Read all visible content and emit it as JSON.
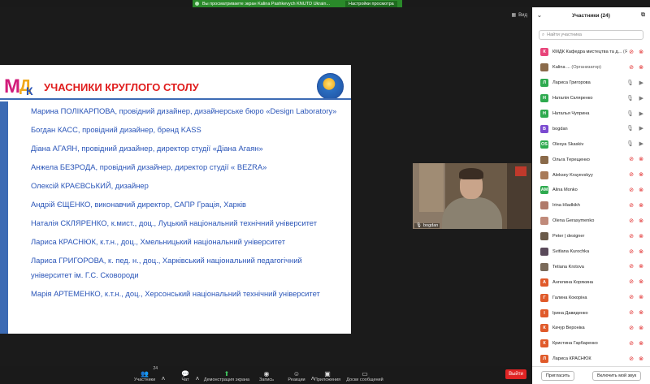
{
  "share_banner": {
    "text": "Вы просматриваете экран Kalina Pashkevych KNUTD Ukrain...",
    "options": "Настройки просмотра"
  },
  "view_label": "Вид",
  "slide": {
    "title": "УЧАСНИКИ КРУГЛОГО СТОЛУ",
    "items": [
      "Марина ПОЛІКАРПОВА, провідний дизайнер, дизайнерське бюро «Design Laboratory»",
      "Богдан КАСС, провідний дизайнер, бренд KASS",
      "Діана АГАЯН, провідний дизайнер, директор студії «Діана Агаян»",
      "Анжела БЕЗРОДА, провідний дизайнер, директор студії « BEZRA»",
      "Олексій КРАЄВСЬКИЙ, дизайнер",
      "Андрій ЄЩЕНКО, виконавчий директор, САПР Грація, Харків",
      "Наталія СКЛЯРЕНКО, к.мист., доц., Луцький національний технічний університет",
      "Лариса КРАСНЮК, к.т.н., доц., Хмельницький національний університет",
      "Лариса ГРИГОРОВА, к. пед. н., доц., Харківський національний педагогічний університет  ім. Г.С. Сковороди",
      "Марія АРТЕМЕНКО, к.т.н., доц., Херсонський національний технічний університет"
    ]
  },
  "camera": {
    "name": "bogdan"
  },
  "toolbar": {
    "audio": "Звук",
    "video": "Видео",
    "participants": "Участники",
    "participants_count": "24",
    "chat": "Чат",
    "share": "Демонстрация экрана",
    "record": "Запись",
    "reactions": "Реакции",
    "apps": "Приложения",
    "whiteboard": "Доски сообщений",
    "end": "Выйти"
  },
  "panel": {
    "title": "Участники (24)",
    "search_placeholder": "Найти участника",
    "participants": [
      {
        "initial": "К",
        "color": "#e8447a",
        "name": "КМДК Кафедра мистецтва та д...",
        "tag": " (Я)",
        "mic": "muted",
        "cam": "off"
      },
      {
        "initial": "",
        "color": "#8a6a4a",
        "name": "Kalina ...",
        "tag": " (Организатор)",
        "mic": "muted",
        "cam": "off"
      },
      {
        "initial": "Л",
        "color": "#2eaa4f",
        "name": "Лариса Григорова",
        "tag": "",
        "mic": "on",
        "cam": "on"
      },
      {
        "initial": "Н",
        "color": "#2eaa4f",
        "name": "Наталія Скляренко",
        "tag": "",
        "mic": "on",
        "cam": "on"
      },
      {
        "initial": "Н",
        "color": "#2eaa4f",
        "name": "Наталья Чуприна",
        "tag": "",
        "mic": "on",
        "cam": "on"
      },
      {
        "initial": "B",
        "color": "#7b4ad0",
        "name": "bogdan",
        "tag": "",
        "mic": "on",
        "cam": "on"
      },
      {
        "initial": "OS",
        "color": "#2eaa4f",
        "name": "Olesya Skaskiv",
        "tag": "",
        "mic": "on",
        "cam": "on"
      },
      {
        "initial": "",
        "color": "#8a6a4a",
        "name": "Ольга Терещенко",
        "tag": "",
        "mic": "muted",
        "cam": "off"
      },
      {
        "initial": "",
        "color": "#a87a58",
        "name": "Aleksey Krayevskyy",
        "tag": "",
        "mic": "muted",
        "cam": "off"
      },
      {
        "initial": "AM",
        "color": "#2eaa4f",
        "name": "Alina Monko",
        "tag": "",
        "mic": "muted",
        "cam": "off"
      },
      {
        "initial": "",
        "color": "#b07a6a",
        "name": "Irina Hladkikh",
        "tag": "",
        "mic": "muted",
        "cam": "off"
      },
      {
        "initial": "",
        "color": "#c08a7a",
        "name": "Olena Gerasymenko",
        "tag": "",
        "mic": "muted",
        "cam": "off"
      },
      {
        "initial": "",
        "color": "#6a5a4a",
        "name": "Peter | designer",
        "tag": "",
        "mic": "muted",
        "cam": "off"
      },
      {
        "initial": "",
        "color": "#5a4a5a",
        "name": "Svitlana Kurochka",
        "tag": "",
        "mic": "muted",
        "cam": "off"
      },
      {
        "initial": "",
        "color": "#7a6a5a",
        "name": "Tetiana Krotova",
        "tag": "",
        "mic": "muted",
        "cam": "off"
      },
      {
        "initial": "А",
        "color": "#e05a2a",
        "name": "Ангелина Корякина",
        "tag": "",
        "mic": "muted",
        "cam": "off"
      },
      {
        "initial": "Г",
        "color": "#e05a2a",
        "name": "Галина Кокоріна",
        "tag": "",
        "mic": "muted",
        "cam": "off"
      },
      {
        "initial": "І",
        "color": "#e05a2a",
        "name": "Ірина Давиденко",
        "tag": "",
        "mic": "muted",
        "cam": "off"
      },
      {
        "initial": "К",
        "color": "#e05a2a",
        "name": "Качур Вероніка",
        "tag": "",
        "mic": "muted",
        "cam": "off"
      },
      {
        "initial": "К",
        "color": "#e05a2a",
        "name": "Кристина Гарбаренко",
        "tag": "",
        "mic": "muted",
        "cam": "off"
      },
      {
        "initial": "Л",
        "color": "#e05a2a",
        "name": "Лариса КРАСНЮК",
        "tag": "",
        "mic": "muted",
        "cam": "off"
      },
      {
        "initial": "",
        "color": "#8a6a4a",
        "name": "Лариса Рябенко",
        "tag": "",
        "mic": "muted",
        "cam": "off"
      }
    ],
    "invite": "Пригласить",
    "unmute_me": "Включить мой звук"
  }
}
